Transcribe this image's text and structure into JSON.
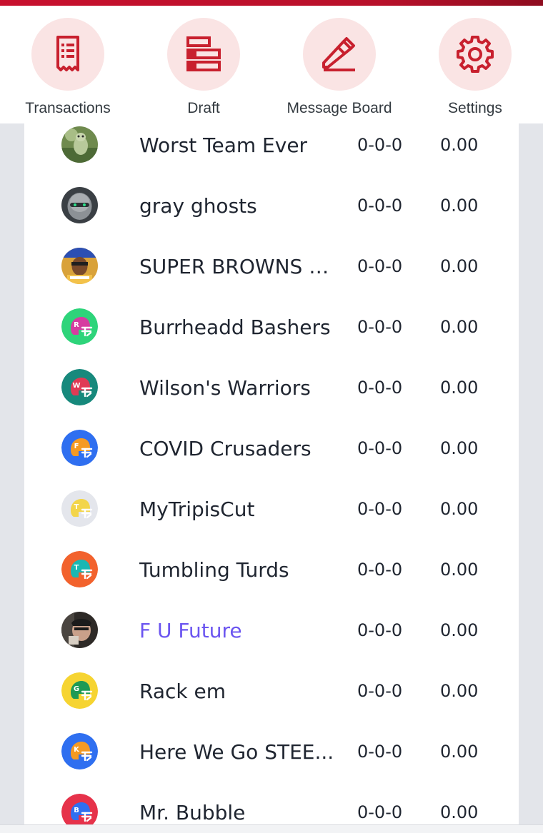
{
  "nav": {
    "items": [
      {
        "label": "Transactions",
        "icon": "receipt-icon"
      },
      {
        "label": "Draft",
        "icon": "draft-board-icon"
      },
      {
        "label": "Message Board",
        "icon": "pencil-icon"
      },
      {
        "label": "Settings",
        "icon": "gear-icon"
      }
    ],
    "icon_color": "#c8202e",
    "circle_color": "#fae4e4"
  },
  "standings": {
    "rows": [
      {
        "name": "Worst Team Ever",
        "record": "0-0-0",
        "points": "0.00",
        "avatar": "photo-frog"
      },
      {
        "name": "gray ghosts",
        "record": "0-0-0",
        "points": "0.00",
        "avatar": "photo-robot"
      },
      {
        "name": "SUPER BROWNS B...",
        "record": "0-0-0",
        "points": "0.00",
        "avatar": "photo-fan"
      },
      {
        "name": "Burrheadd Bashers",
        "record": "0-0-0",
        "points": "0.00",
        "avatar": "helmet",
        "letter": "R",
        "bg": "#2ed47a",
        "helmet": "#d63ca0"
      },
      {
        "name": "Wilson's Warriors",
        "record": "0-0-0",
        "points": "0.00",
        "avatar": "helmet",
        "letter": "W",
        "bg": "#17897c",
        "helmet": "#e03a55"
      },
      {
        "name": "COVID Crusaders",
        "record": "0-0-0",
        "points": "0.00",
        "avatar": "helmet",
        "letter": "F",
        "bg": "#2f6ff0",
        "helmet": "#f59a22"
      },
      {
        "name": "MyTripisCut",
        "record": "0-0-0",
        "points": "0.00",
        "avatar": "helmet",
        "letter": "T",
        "bg": "#e4e6ec",
        "helmet": "#f3d54a"
      },
      {
        "name": "Tumbling Turds",
        "record": "0-0-0",
        "points": "0.00",
        "avatar": "helmet",
        "letter": "T",
        "bg": "#f2622d",
        "helmet": "#1bb7b3"
      },
      {
        "name": "F U Future",
        "record": "0-0-0",
        "points": "0.00",
        "avatar": "photo-man",
        "highlight": true
      },
      {
        "name": "Rack em",
        "record": "0-0-0",
        "points": "0.00",
        "avatar": "helmet",
        "letter": "G",
        "bg": "#f6d431",
        "helmet": "#1e9a55"
      },
      {
        "name": "Here We Go  STEE...",
        "record": "0-0-0",
        "points": "0.00",
        "avatar": "helmet",
        "letter": "K",
        "bg": "#2f6ff0",
        "helmet": "#f59a22"
      },
      {
        "name": "Mr. Bubble",
        "record": "0-0-0",
        "points": "0.00",
        "avatar": "helmet",
        "letter": "B",
        "bg": "#e6324a",
        "helmet": "#2f6ff0"
      }
    ],
    "highlight_color": "#6b55f0"
  }
}
